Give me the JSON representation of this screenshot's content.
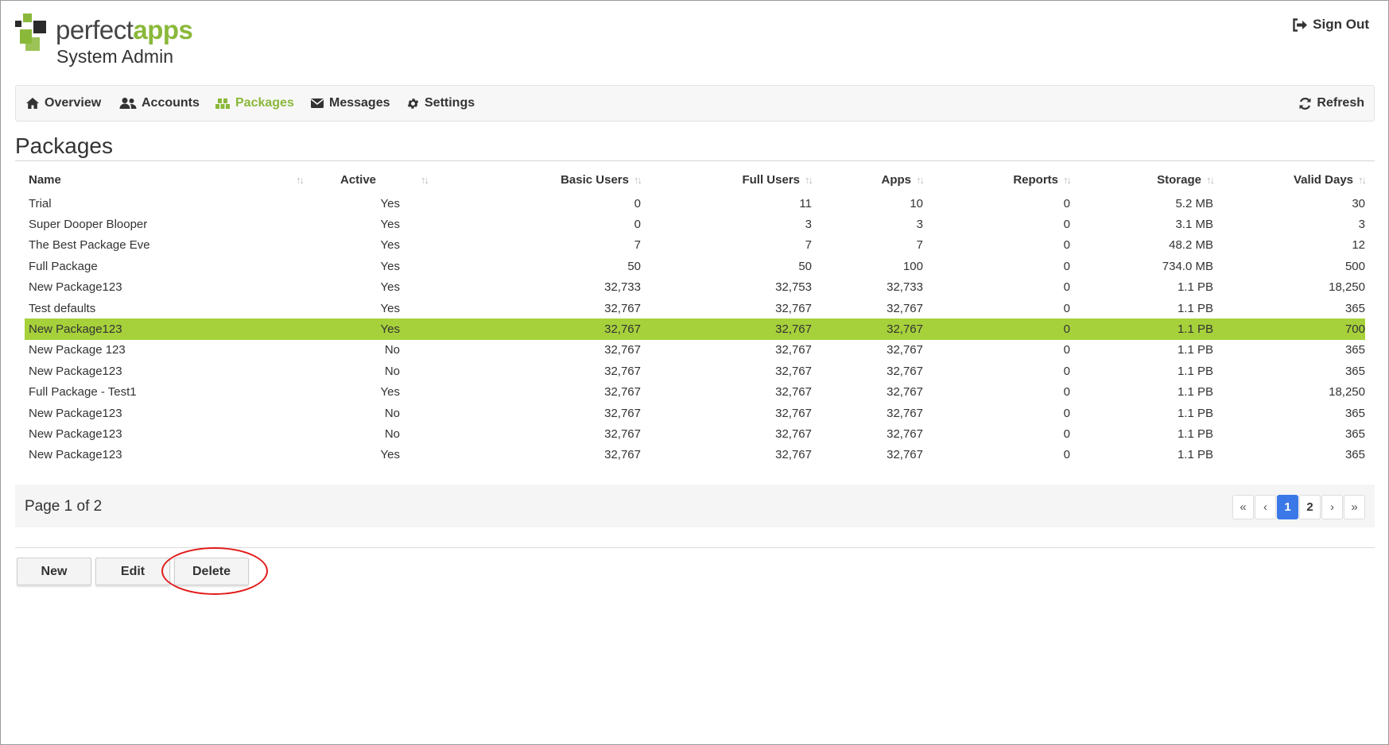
{
  "brand": {
    "word1": "perfect",
    "word2": "apps",
    "subtitle": "System Admin"
  },
  "header": {
    "signout_label": "Sign Out"
  },
  "nav": {
    "items": [
      {
        "label": "Overview"
      },
      {
        "label": "Accounts"
      },
      {
        "label": "Packages",
        "active": true
      },
      {
        "label": "Messages"
      },
      {
        "label": "Settings"
      }
    ],
    "refresh_label": "Refresh"
  },
  "page": {
    "title": "Packages"
  },
  "table": {
    "columns": [
      "Name",
      "Active",
      "Basic Users",
      "Full Users",
      "Apps",
      "Reports",
      "Storage",
      "Valid Days"
    ],
    "sort_glyph": "↑↓",
    "rows": [
      [
        "Trial",
        "Yes",
        "0",
        "11",
        "10",
        "0",
        "5.2 MB",
        "30"
      ],
      [
        "Super Dooper Blooper",
        "Yes",
        "0",
        "3",
        "3",
        "0",
        "3.1 MB",
        "3"
      ],
      [
        "The Best Package Eve",
        "Yes",
        "7",
        "7",
        "7",
        "0",
        "48.2 MB",
        "12"
      ],
      [
        "Full Package",
        "Yes",
        "50",
        "50",
        "100",
        "0",
        "734.0 MB",
        "500"
      ],
      [
        "New Package123",
        "Yes",
        "32,733",
        "32,753",
        "32,733",
        "0",
        "1.1 PB",
        "18,250"
      ],
      [
        "Test defaults",
        "Yes",
        "32,767",
        "32,767",
        "32,767",
        "0",
        "1.1 PB",
        "365"
      ],
      [
        "New Package123",
        "Yes",
        "32,767",
        "32,767",
        "32,767",
        "0",
        "1.1 PB",
        "700"
      ],
      [
        "New Package 123",
        "No",
        "32,767",
        "32,767",
        "32,767",
        "0",
        "1.1 PB",
        "365"
      ],
      [
        "New Package123",
        "No",
        "32,767",
        "32,767",
        "32,767",
        "0",
        "1.1 PB",
        "365"
      ],
      [
        "Full Package - Test1",
        "Yes",
        "32,767",
        "32,767",
        "32,767",
        "0",
        "1.1 PB",
        "18,250"
      ],
      [
        "New Package123",
        "No",
        "32,767",
        "32,767",
        "32,767",
        "0",
        "1.1 PB",
        "365"
      ],
      [
        "New Package123",
        "No",
        "32,767",
        "32,767",
        "32,767",
        "0",
        "1.1 PB",
        "365"
      ],
      [
        "New Package123",
        "Yes",
        "32,767",
        "32,767",
        "32,767",
        "0",
        "1.1 PB",
        "365"
      ]
    ],
    "selected_row": 6
  },
  "pager": {
    "info": "Page 1 of 2",
    "first": "«",
    "prev": "‹",
    "pages": [
      "1",
      "2"
    ],
    "current": "1",
    "next": "›",
    "last": "»"
  },
  "actions": {
    "new_label": "New",
    "edit_label": "Edit",
    "delete_label": "Delete"
  },
  "colors": {
    "brand_green": "#8ab83a",
    "selected_row": "#a6d13b",
    "active_page": "#3b78e7",
    "annotation_ring": "#e21b1b"
  }
}
